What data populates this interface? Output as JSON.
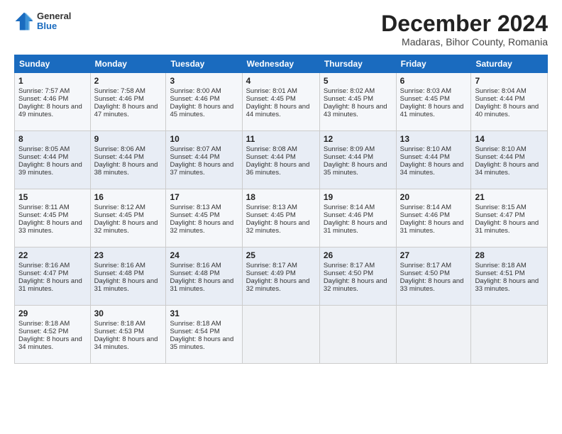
{
  "header": {
    "logo": {
      "line1": "General",
      "line2": "Blue"
    },
    "title": "December 2024",
    "subtitle": "Madaras, Bihor County, Romania"
  },
  "days_of_week": [
    "Sunday",
    "Monday",
    "Tuesday",
    "Wednesday",
    "Thursday",
    "Friday",
    "Saturday"
  ],
  "weeks": [
    [
      {
        "day": "1",
        "sunrise": "Sunrise: 7:57 AM",
        "sunset": "Sunset: 4:46 PM",
        "daylight": "Daylight: 8 hours and 49 minutes."
      },
      {
        "day": "2",
        "sunrise": "Sunrise: 7:58 AM",
        "sunset": "Sunset: 4:46 PM",
        "daylight": "Daylight: 8 hours and 47 minutes."
      },
      {
        "day": "3",
        "sunrise": "Sunrise: 8:00 AM",
        "sunset": "Sunset: 4:46 PM",
        "daylight": "Daylight: 8 hours and 45 minutes."
      },
      {
        "day": "4",
        "sunrise": "Sunrise: 8:01 AM",
        "sunset": "Sunset: 4:45 PM",
        "daylight": "Daylight: 8 hours and 44 minutes."
      },
      {
        "day": "5",
        "sunrise": "Sunrise: 8:02 AM",
        "sunset": "Sunset: 4:45 PM",
        "daylight": "Daylight: 8 hours and 43 minutes."
      },
      {
        "day": "6",
        "sunrise": "Sunrise: 8:03 AM",
        "sunset": "Sunset: 4:45 PM",
        "daylight": "Daylight: 8 hours and 41 minutes."
      },
      {
        "day": "7",
        "sunrise": "Sunrise: 8:04 AM",
        "sunset": "Sunset: 4:44 PM",
        "daylight": "Daylight: 8 hours and 40 minutes."
      }
    ],
    [
      {
        "day": "8",
        "sunrise": "Sunrise: 8:05 AM",
        "sunset": "Sunset: 4:44 PM",
        "daylight": "Daylight: 8 hours and 39 minutes."
      },
      {
        "day": "9",
        "sunrise": "Sunrise: 8:06 AM",
        "sunset": "Sunset: 4:44 PM",
        "daylight": "Daylight: 8 hours and 38 minutes."
      },
      {
        "day": "10",
        "sunrise": "Sunrise: 8:07 AM",
        "sunset": "Sunset: 4:44 PM",
        "daylight": "Daylight: 8 hours and 37 minutes."
      },
      {
        "day": "11",
        "sunrise": "Sunrise: 8:08 AM",
        "sunset": "Sunset: 4:44 PM",
        "daylight": "Daylight: 8 hours and 36 minutes."
      },
      {
        "day": "12",
        "sunrise": "Sunrise: 8:09 AM",
        "sunset": "Sunset: 4:44 PM",
        "daylight": "Daylight: 8 hours and 35 minutes."
      },
      {
        "day": "13",
        "sunrise": "Sunrise: 8:10 AM",
        "sunset": "Sunset: 4:44 PM",
        "daylight": "Daylight: 8 hours and 34 minutes."
      },
      {
        "day": "14",
        "sunrise": "Sunrise: 8:10 AM",
        "sunset": "Sunset: 4:44 PM",
        "daylight": "Daylight: 8 hours and 34 minutes."
      }
    ],
    [
      {
        "day": "15",
        "sunrise": "Sunrise: 8:11 AM",
        "sunset": "Sunset: 4:45 PM",
        "daylight": "Daylight: 8 hours and 33 minutes."
      },
      {
        "day": "16",
        "sunrise": "Sunrise: 8:12 AM",
        "sunset": "Sunset: 4:45 PM",
        "daylight": "Daylight: 8 hours and 32 minutes."
      },
      {
        "day": "17",
        "sunrise": "Sunrise: 8:13 AM",
        "sunset": "Sunset: 4:45 PM",
        "daylight": "Daylight: 8 hours and 32 minutes."
      },
      {
        "day": "18",
        "sunrise": "Sunrise: 8:13 AM",
        "sunset": "Sunset: 4:45 PM",
        "daylight": "Daylight: 8 hours and 32 minutes."
      },
      {
        "day": "19",
        "sunrise": "Sunrise: 8:14 AM",
        "sunset": "Sunset: 4:46 PM",
        "daylight": "Daylight: 8 hours and 31 minutes."
      },
      {
        "day": "20",
        "sunrise": "Sunrise: 8:14 AM",
        "sunset": "Sunset: 4:46 PM",
        "daylight": "Daylight: 8 hours and 31 minutes."
      },
      {
        "day": "21",
        "sunrise": "Sunrise: 8:15 AM",
        "sunset": "Sunset: 4:47 PM",
        "daylight": "Daylight: 8 hours and 31 minutes."
      }
    ],
    [
      {
        "day": "22",
        "sunrise": "Sunrise: 8:16 AM",
        "sunset": "Sunset: 4:47 PM",
        "daylight": "Daylight: 8 hours and 31 minutes."
      },
      {
        "day": "23",
        "sunrise": "Sunrise: 8:16 AM",
        "sunset": "Sunset: 4:48 PM",
        "daylight": "Daylight: 8 hours and 31 minutes."
      },
      {
        "day": "24",
        "sunrise": "Sunrise: 8:16 AM",
        "sunset": "Sunset: 4:48 PM",
        "daylight": "Daylight: 8 hours and 31 minutes."
      },
      {
        "day": "25",
        "sunrise": "Sunrise: 8:17 AM",
        "sunset": "Sunset: 4:49 PM",
        "daylight": "Daylight: 8 hours and 32 minutes."
      },
      {
        "day": "26",
        "sunrise": "Sunrise: 8:17 AM",
        "sunset": "Sunset: 4:50 PM",
        "daylight": "Daylight: 8 hours and 32 minutes."
      },
      {
        "day": "27",
        "sunrise": "Sunrise: 8:17 AM",
        "sunset": "Sunset: 4:50 PM",
        "daylight": "Daylight: 8 hours and 33 minutes."
      },
      {
        "day": "28",
        "sunrise": "Sunrise: 8:18 AM",
        "sunset": "Sunset: 4:51 PM",
        "daylight": "Daylight: 8 hours and 33 minutes."
      }
    ],
    [
      {
        "day": "29",
        "sunrise": "Sunrise: 8:18 AM",
        "sunset": "Sunset: 4:52 PM",
        "daylight": "Daylight: 8 hours and 34 minutes."
      },
      {
        "day": "30",
        "sunrise": "Sunrise: 8:18 AM",
        "sunset": "Sunset: 4:53 PM",
        "daylight": "Daylight: 8 hours and 34 minutes."
      },
      {
        "day": "31",
        "sunrise": "Sunrise: 8:18 AM",
        "sunset": "Sunset: 4:54 PM",
        "daylight": "Daylight: 8 hours and 35 minutes."
      },
      null,
      null,
      null,
      null
    ]
  ]
}
